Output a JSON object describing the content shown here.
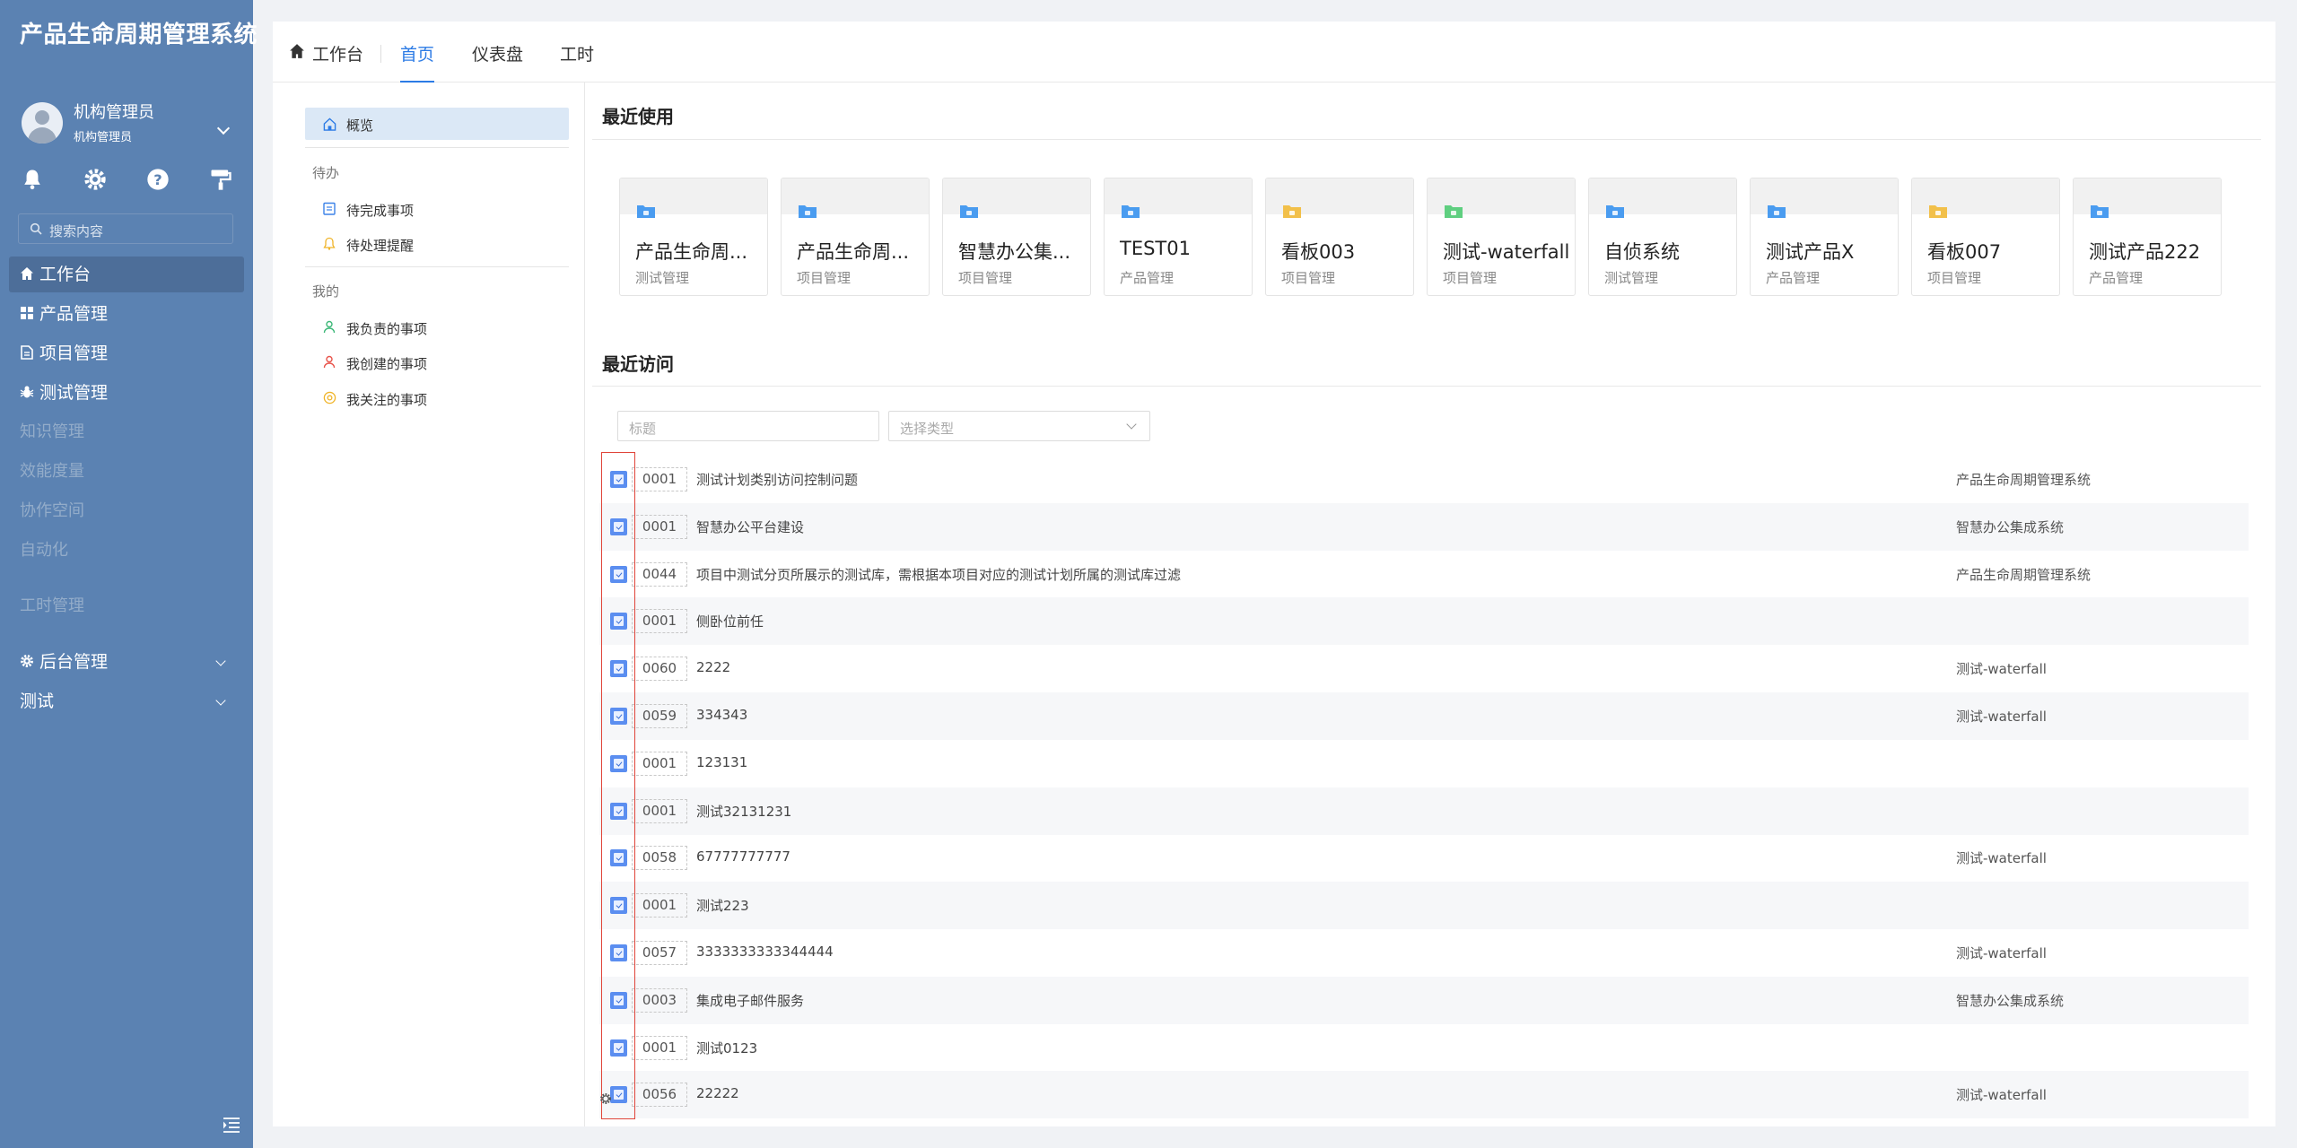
{
  "app": {
    "title": "产品生命周期管理系统"
  },
  "user": {
    "name": "机构管理员",
    "role": "机构管理员"
  },
  "search": {
    "placeholder": "搜索内容"
  },
  "quick_icons": [
    "bell-icon",
    "gear-icon",
    "help-icon",
    "paint-roller-icon"
  ],
  "nav": {
    "items": [
      {
        "label": "工作台",
        "icon": "home-icon",
        "state": "active"
      },
      {
        "label": "产品管理",
        "icon": "grid-icon"
      },
      {
        "label": "项目管理",
        "icon": "document-icon"
      },
      {
        "label": "测试管理",
        "icon": "bug-icon"
      },
      {
        "label": "知识管理",
        "state": "disabled"
      },
      {
        "label": "效能度量",
        "state": "disabled"
      },
      {
        "label": "协作空间",
        "state": "disabled"
      },
      {
        "label": "自动化",
        "state": "disabled"
      },
      {
        "label": "工时管理",
        "state": "disabled"
      },
      {
        "label": "后台管理",
        "icon": "gear-icon",
        "expandable": true
      },
      {
        "label": "测试",
        "expandable": true
      }
    ]
  },
  "topbar": {
    "home_label": "工作台",
    "tabs": [
      {
        "label": "首页",
        "active": true
      },
      {
        "label": "仪表盘"
      },
      {
        "label": "工时"
      }
    ]
  },
  "left_panel": {
    "overview": "概览",
    "todo_header": "待办",
    "todo_items": [
      "待完成事项",
      "待处理提醒"
    ],
    "mine_header": "我的",
    "mine_items": [
      "我负责的事项",
      "我创建的事项",
      "我关注的事项"
    ]
  },
  "recent_used": {
    "title": "最近使用",
    "cards": [
      {
        "name": "产品生命周...",
        "type": "测试管理",
        "color": "#4a9cf0"
      },
      {
        "name": "产品生命周...",
        "type": "项目管理",
        "color": "#4a9cf0"
      },
      {
        "name": "智慧办公集...",
        "type": "项目管理",
        "color": "#4a9cf0"
      },
      {
        "name": "TEST01",
        "type": "产品管理",
        "color": "#4a9cf0"
      },
      {
        "name": "看板003",
        "type": "项目管理",
        "color": "#f2c04a"
      },
      {
        "name": "测试-waterfall",
        "type": "项目管理",
        "color": "#5fcf80"
      },
      {
        "name": "自侦系统",
        "type": "测试管理",
        "color": "#4a9cf0"
      },
      {
        "name": "测试产品X",
        "type": "产品管理",
        "color": "#4a9cf0"
      },
      {
        "name": "看板007",
        "type": "项目管理",
        "color": "#f2c04a"
      },
      {
        "name": "测试产品222",
        "type": "产品管理",
        "color": "#4a9cf0"
      }
    ]
  },
  "recent_visit": {
    "title": "最近访问",
    "filter_title_placeholder": "标题",
    "filter_type_placeholder": "选择类型",
    "rows": [
      {
        "code": "0001",
        "title": "测试计划类别访问控制问题",
        "project": "产品生命周期管理系统"
      },
      {
        "code": "0001",
        "title": "智慧办公平台建设",
        "project": "智慧办公集成系统"
      },
      {
        "code": "0044",
        "title": "项目中测试分页所展示的测试库，需根据本项目对应的测试计划所属的测试库过滤",
        "project": "产品生命周期管理系统"
      },
      {
        "code": "0001",
        "title": "侧卧位前任",
        "project": ""
      },
      {
        "code": "0060",
        "title": "2222",
        "project": "测试-waterfall"
      },
      {
        "code": "0059",
        "title": "334343",
        "project": "测试-waterfall"
      },
      {
        "code": "0001",
        "title": "123131",
        "project": ""
      },
      {
        "code": "0001",
        "title": "测试32131231",
        "project": ""
      },
      {
        "code": "0058",
        "title": "67777777777",
        "project": "测试-waterfall"
      },
      {
        "code": "0001",
        "title": "测试223",
        "project": ""
      },
      {
        "code": "0057",
        "title": "3333333333344444",
        "project": "测试-waterfall"
      },
      {
        "code": "0003",
        "title": "集成电子邮件服务",
        "project": "智慧办公集成系统"
      },
      {
        "code": "0001",
        "title": "测试0123",
        "project": ""
      },
      {
        "code": "0056",
        "title": "22222",
        "project": "测试-waterfall"
      }
    ]
  }
}
